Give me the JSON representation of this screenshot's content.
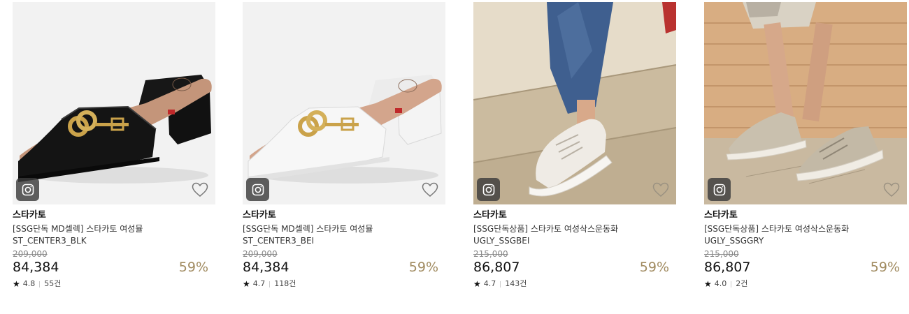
{
  "accent_discount_color": "#a08a5f",
  "products": [
    {
      "brand": "스타카토",
      "name_line1": "[SSG단독 MD셀렉] 스타카토 여성뮬",
      "name_line2": "ST_CENTER3_BLK",
      "original_price": "209,000",
      "price": "84,384",
      "discount": "59%",
      "rating": "4.8",
      "reviews": "55건",
      "image": "black-heeled-mule"
    },
    {
      "brand": "스타카토",
      "name_line1": "[SSG단독 MD셀렉] 스타카토 여성뮬",
      "name_line2": "ST_CENTER3_BEI",
      "original_price": "209,000",
      "price": "84,384",
      "discount": "59%",
      "rating": "4.7",
      "reviews": "118건",
      "image": "white-heeled-mule"
    },
    {
      "brand": "스타카토",
      "name_line1": "[SSG단독상품] 스타카토 여성삭스운동화",
      "name_line2": "UGLY_SSGBEI",
      "original_price": "215,000",
      "price": "86,807",
      "discount": "59%",
      "rating": "4.7",
      "reviews": "143건",
      "image": "beige-sock-sneaker-on-stairs"
    },
    {
      "brand": "스타카토",
      "name_line1": "[SSG단독상품] 스타카토 여성삭스운동화",
      "name_line2": "UGLY_SSGGRY",
      "original_price": "215,000",
      "price": "86,807",
      "discount": "59%",
      "rating": "4.0",
      "reviews": "2건",
      "image": "grey-sock-sneaker-against-wall"
    }
  ]
}
